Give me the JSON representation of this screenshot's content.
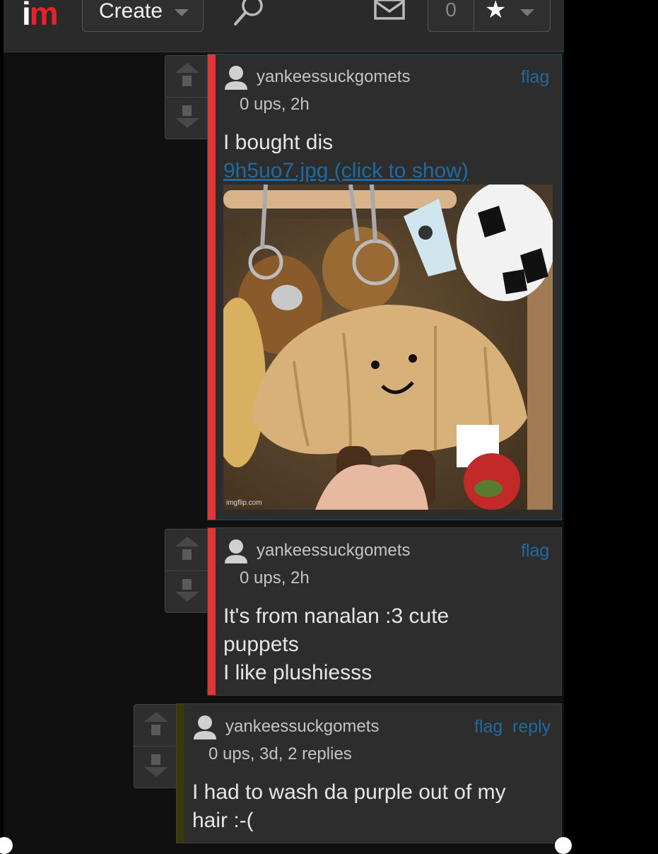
{
  "header": {
    "logo": {
      "part1": "i",
      "part2": "m"
    },
    "create_label": "Create",
    "notification_count": "0",
    "icons": [
      "search-icon",
      "mail-icon",
      "star-icon",
      "chevron-down-icon"
    ]
  },
  "comments": [
    {
      "username": "yankeessuckgomets",
      "meta": "0 ups, 2h",
      "flag": "flag",
      "text": "I bought dis",
      "image_link": "9h5uo7.jpg (click to show)",
      "image_watermark": "imgflip.com",
      "bar_color": "#e03636"
    },
    {
      "username": "yankeessuckgomets",
      "meta": "0 ups, 2h",
      "flag": "flag",
      "lines": [
        "It's from nanalan :3 cute",
        "puppets",
        "I like plushiesss"
      ],
      "bar_color": "#e03636"
    },
    {
      "username": "yankeessuckgomets",
      "meta": "0 ups, 3d, 2 replies",
      "flag": "flag",
      "reply": "reply",
      "lines": [
        "I had to wash da purple out of my",
        "hair :-("
      ],
      "bar_color": "#38380c"
    }
  ],
  "colors": {
    "link": "#1f6aa0",
    "accent_red": "#e03636",
    "background": "#101010",
    "panel": "#2d2d2d"
  }
}
